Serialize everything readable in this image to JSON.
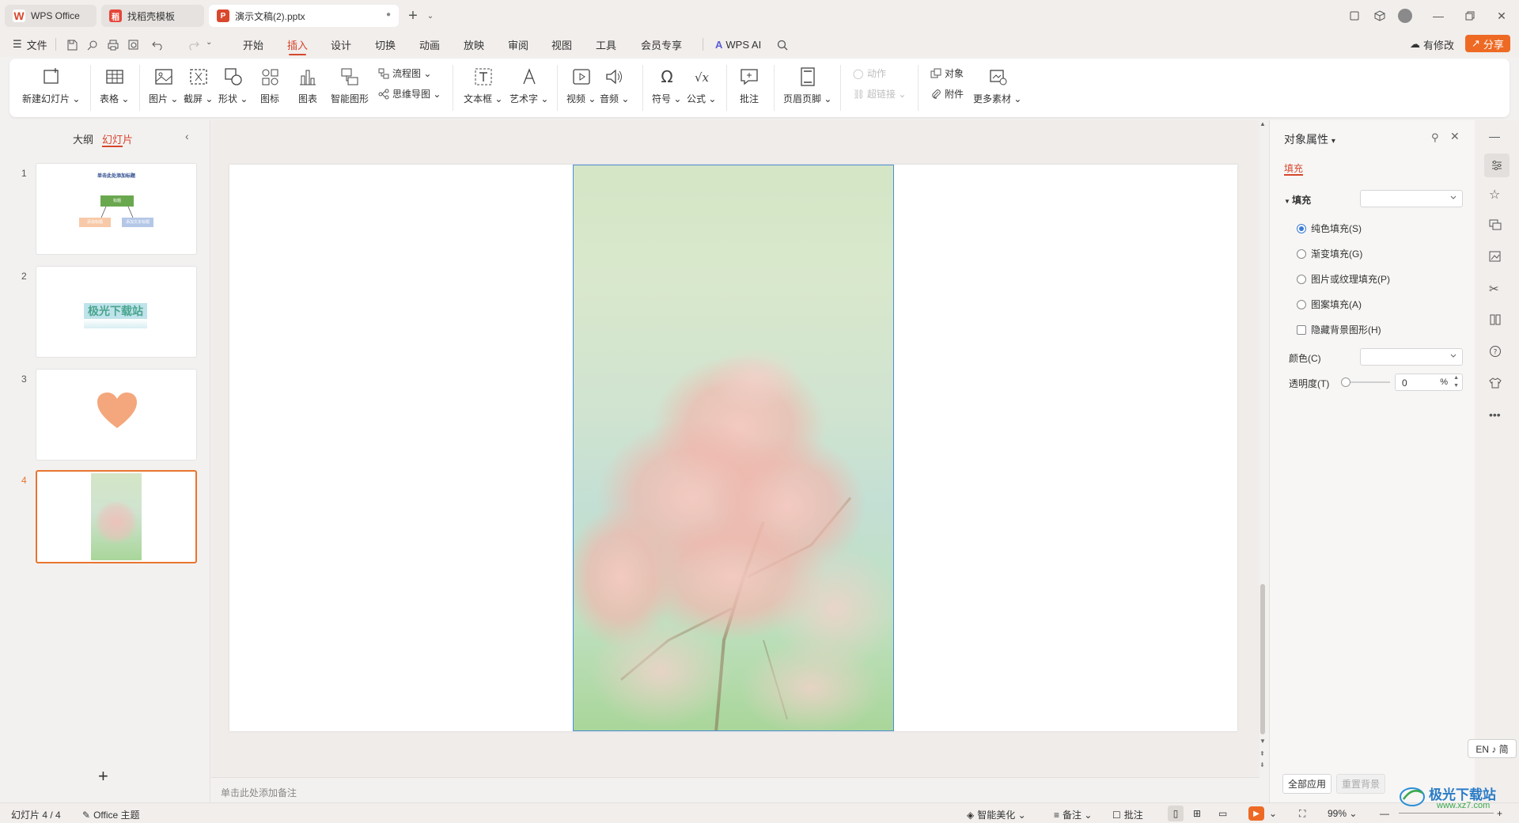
{
  "tabs": [
    {
      "label": "WPS Office"
    },
    {
      "label": "找稻壳模板"
    },
    {
      "label": "演示文稿(2).pptx"
    }
  ],
  "menu": {
    "file": "文件",
    "items": [
      "开始",
      "插入",
      "设计",
      "切换",
      "动画",
      "放映",
      "审阅",
      "视图",
      "工具",
      "会员专享"
    ],
    "active": "插入",
    "ai": "WPS AI",
    "changes": "有修改",
    "share": "分享"
  },
  "ribbon": {
    "new_slide": "新建幻灯片",
    "table": "表格",
    "picture": "图片",
    "screenshot": "截屏",
    "shape": "形状",
    "icon": "图标",
    "chart": "图表",
    "smartart": "智能图形",
    "flowchart": "流程图",
    "mindmap": "思维导图",
    "textbox": "文本框",
    "wordart": "艺术字",
    "video": "视频",
    "audio": "音频",
    "symbol": "符号",
    "formula": "公式",
    "comment": "批注",
    "header_footer": "页眉页脚",
    "action": "动作",
    "hyperlink": "超链接",
    "object": "对象",
    "attachment": "附件",
    "more": "更多素材"
  },
  "leftpanel": {
    "outline_tab": "大纲",
    "slides_tab": "幻灯片",
    "slides": [
      {
        "num": "1",
        "title": "单击此处添加标题",
        "box1": "标题",
        "box2": "添加标题",
        "box3": "添加文本标题"
      },
      {
        "num": "2",
        "text": "极光下载站"
      },
      {
        "num": "3"
      },
      {
        "num": "4"
      }
    ]
  },
  "notes_placeholder": "单击此处添加备注",
  "rightpanel": {
    "title": "对象属性",
    "tab": "填充",
    "section": "填充",
    "options": [
      "纯色填充(S)",
      "渐变填充(G)",
      "图片或纹理填充(P)",
      "图案填充(A)"
    ],
    "selected_option": "纯色填充(S)",
    "hide_bg": "隐藏背景图形(H)",
    "color_label": "颜色(C)",
    "transparency_label": "透明度(T)",
    "transparency_value": "0",
    "transparency_unit": "%",
    "apply_all": "全部应用",
    "reset_bg": "重置背景"
  },
  "ime": "EN ♪ 简",
  "status": {
    "slide_info": "幻灯片 4 / 4",
    "theme": "Office 主题",
    "beautify": "智能美化",
    "notes": "备注",
    "comments": "批注",
    "zoom": "99%"
  },
  "watermark": {
    "text": "极光下载站",
    "url": "www.xz7.com"
  },
  "colors": {
    "accent": "#d7472e",
    "share": "#ee6a24",
    "selection": "#e8752f",
    "heart": "#f4a77c"
  }
}
